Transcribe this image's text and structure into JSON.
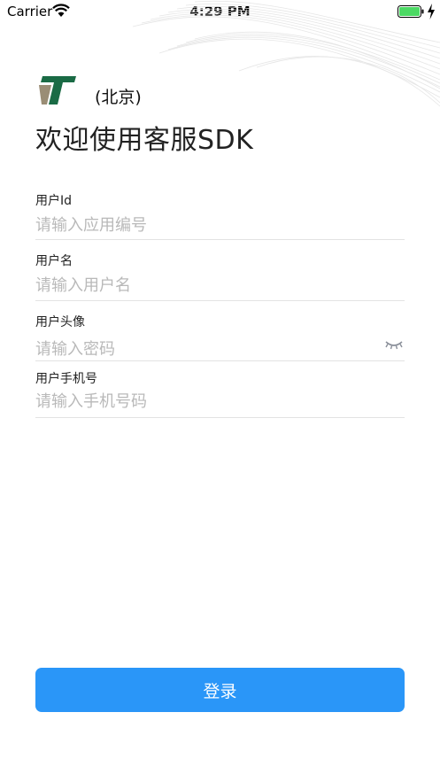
{
  "status_bar": {
    "carrier": "Carrier",
    "time": "4:29 PM",
    "icons": [
      "wifi-icon",
      "battery-icon",
      "charging-icon"
    ]
  },
  "header": {
    "logo": "logo-icon",
    "region": "(北京)",
    "welcome": "欢迎使用客服SDK"
  },
  "form": {
    "fields": [
      {
        "label": "用户Id",
        "placeholder": "请输入应用编号"
      },
      {
        "label": "用户名",
        "placeholder": "请输入用户名"
      },
      {
        "label": "用户头像",
        "placeholder": "请输入密码"
      },
      {
        "label": "用户手机号",
        "placeholder": "请输入手机号码"
      }
    ],
    "password_toggle_icon": "eye-closed-icon"
  },
  "login": {
    "label": "登录"
  },
  "colors": {
    "accent": "#2a96f8",
    "logo_green": "#1a6b45",
    "logo_tan": "#9a8d75",
    "placeholder": "#b9b9b9",
    "divider": "#e3e3e3"
  }
}
